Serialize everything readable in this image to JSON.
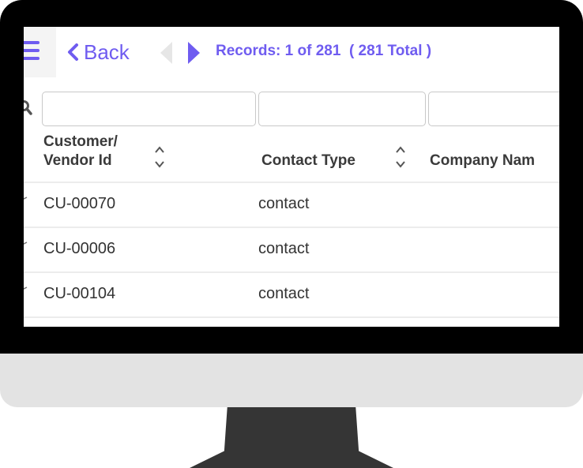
{
  "toolbar": {
    "back_label": "Back",
    "records_text": "Records: 1 of 281  ( 281 Total )"
  },
  "colors": {
    "accent": "#6f5cf0",
    "nav_disabled": "#e6e6e6",
    "bezel": "#000000",
    "chin": "#e3e3e3",
    "stand": "#353535"
  },
  "icons": [
    "menu-icon",
    "chevron-left-icon",
    "prev-record-icon",
    "next-record-icon",
    "search-icon",
    "sort-icon",
    "edit-icon"
  ],
  "filters": [
    {
      "value": "",
      "placeholder": ""
    },
    {
      "value": "",
      "placeholder": ""
    },
    {
      "value": "",
      "placeholder": ""
    }
  ],
  "table": {
    "columns": [
      {
        "label_line1": "Customer/",
        "label_line2": "Vendor Id"
      },
      {
        "label": "Contact Type"
      },
      {
        "label": "Company Nam"
      }
    ],
    "rows": [
      {
        "id": "CU-00070",
        "contact_type": "contact",
        "company": ""
      },
      {
        "id": "CU-00006",
        "contact_type": "contact",
        "company": ""
      },
      {
        "id": "CU-00104",
        "contact_type": "contact",
        "company": ""
      }
    ]
  }
}
